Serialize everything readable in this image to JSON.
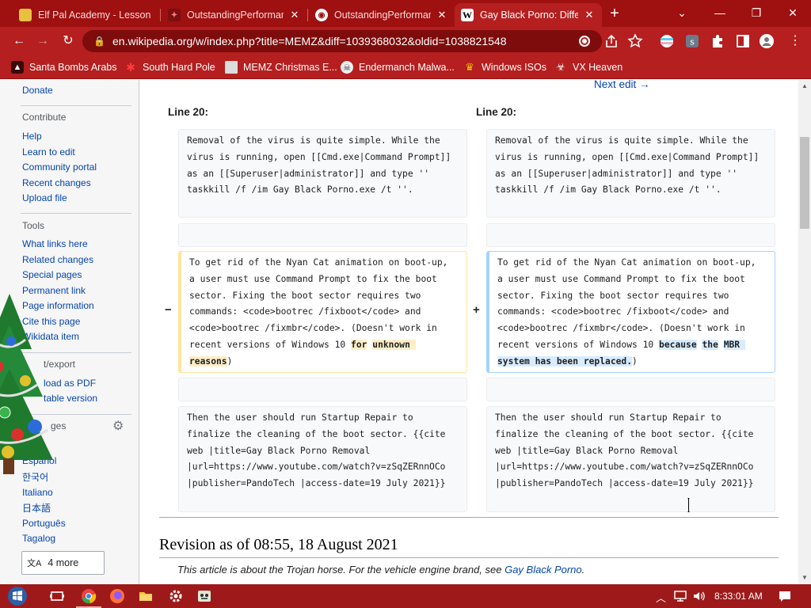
{
  "browser": {
    "tabs": [
      {
        "title": "Elf Pal Academy - Lesson",
        "favicon": "elf-icon",
        "active": false
      },
      {
        "title": "OutstandingPerformance",
        "favicon": "thunder-icon",
        "active": false
      },
      {
        "title": "OutstandingPerformance",
        "favicon": "globe-icon",
        "active": false
      },
      {
        "title": "Gay Black Porno: Difference",
        "favicon": "wikipedia-icon",
        "active": true
      }
    ],
    "new_tab_label": "+",
    "url": "en.wikipedia.org/w/index.php?title=MEMZ&diff=1039368032&oldid=1038821548",
    "bookmarks": [
      {
        "label": "Santa Bombs Arabs",
        "icon": "santa-icon"
      },
      {
        "label": "South Hard Pole",
        "icon": "maple-icon"
      },
      {
        "label": "MEMZ Christmas E...",
        "icon": "image-icon"
      },
      {
        "label": "Endermanch Malwa...",
        "icon": "skull-icon"
      },
      {
        "label": "Windows ISOs",
        "icon": "trophy-icon"
      },
      {
        "label": "VX Heaven",
        "icon": "biohazard-icon"
      }
    ],
    "accent_color": "#b51f1f"
  },
  "sidebar": {
    "top_link": "Donate",
    "contribute": {
      "heading": "Contribute",
      "items": [
        "Help",
        "Learn to edit",
        "Community portal",
        "Recent changes",
        "Upload file"
      ]
    },
    "tools": {
      "heading": "Tools",
      "items": [
        "What links here",
        "Related changes",
        "Special pages",
        "Permanent link",
        "Page information",
        "Cite this page",
        "Wikidata item"
      ]
    },
    "print": {
      "heading": "t/export",
      "items": [
        "load as PDF",
        "table version"
      ]
    },
    "languages": {
      "heading": "ges",
      "items": [
        "Español",
        "한국어",
        "Italiano",
        "日本語",
        "Português",
        "Tagalog"
      ],
      "more_label": "4 more"
    }
  },
  "diff": {
    "next_edit": "Next edit →",
    "line_label_left": "Line 20:",
    "line_label_right": "Line 20:",
    "block1": "Removal of the virus is quite simple. While the virus is running, open [[Cmd.exe|Command Prompt]] as an [[Superuser|administrator]] and type '' taskkill /f /im Gay Black Porno.exe /t ''.",
    "changed_prefix": "To get rid of the Nyan Cat animation on boot-up, a user must use Command Prompt to fix the boot sector. Fixing the boot sector requires two commands: <code>bootrec /fixboot</code> and <code>bootrec /fixmbr</code>. (Doesn't work in recent versions of Windows 10 ",
    "changed_deleted_1": "for",
    "changed_deleted_2": "unknown reasons",
    "changed_added_1": "because",
    "changed_added_2": "the",
    "changed_added_3": "MBR system has been replaced.",
    "changed_suffix": ")",
    "marker_minus": "−",
    "marker_plus": "+",
    "block3": "Then the user should run Startup Repair to finalize the cleaning of the boot sector. {{cite web |title=Gay Black Porno Removal |url=https://www.youtube.com/watch?v=zSqZERnnOCo |publisher=PandoTech |access-date=19 July 2021}}"
  },
  "revision": {
    "title": "Revision as of 08:55, 18 August 2021",
    "hatnote_prefix": "This article is about the Trojan horse. For the vehicle engine brand, see ",
    "hatnote_link": "Gay Black Porno",
    "hatnote_suffix": "."
  },
  "taskbar": {
    "clock": "8:33:01 AM"
  }
}
